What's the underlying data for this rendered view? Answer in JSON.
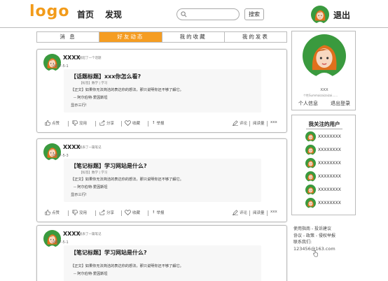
{
  "header": {
    "logo": "logo",
    "nav": [
      "首页",
      "发现"
    ],
    "search_placeholder": "",
    "search_button": "搜索",
    "logout": "退出"
  },
  "tabs": [
    {
      "label": "消 息",
      "active": false
    },
    {
      "label": "好友动态",
      "active": true
    },
    {
      "label": "我的收藏",
      "active": false
    },
    {
      "label": "我的发表",
      "active": false
    }
  ],
  "feed": [
    {
      "user": "XXXX",
      "action": "发起了一个话题",
      "date": "2017-5-1",
      "title": "【话题标题】xxx你怎么看?",
      "tags": "【标签】数学 | 学习",
      "body": "【正文】如果你无法简洁的表达你的想法，那只说明你还不够了解它。",
      "quote": "-- 阿尔伯特·爱因斯坦",
      "more": "显示三行!"
    },
    {
      "user": "XXXX",
      "action": "发表了一篇笔记",
      "date": "2017-5-3",
      "title": "【笔记标题】学习网站是什么?",
      "tags": "【标签】数学 | 学习",
      "body": "【正文】如果你无法简洁的表达你的想法，那只说明你还不够了解它。",
      "quote": "-- 阿尔伯特·爱因斯坦",
      "more": "显示三行!"
    },
    {
      "user": "XXXX",
      "action": "发表了一篇笔记",
      "date": "2017-5-1",
      "title": "【笔记标题】学习网站是什么?",
      "tags": "",
      "body": "【正文】如果你无法简洁的表达你的想法，那只说明你还不够了解它。",
      "quote": "-- 阿尔伯特·爱因斯坦",
      "more": ""
    }
  ],
  "card_actions": {
    "like": "点赞",
    "dislike": "没用",
    "share": "分享",
    "favorite": "收藏",
    "report": "举报",
    "comment": "评论",
    "views_label": "阅读量",
    "views_value": "xxx"
  },
  "profile": {
    "name": "XXX",
    "signature": "个性Summaizaizaizai......",
    "info_link": "个人信息",
    "logout_link": "退出登录"
  },
  "follows": {
    "title": "我关注的用户",
    "users": [
      "XXXXXXXX",
      "XXXXXXXX",
      "XXXXXXXX",
      "XXXXXXXX",
      "XXXXXXXX",
      "XXXXXXXX"
    ]
  },
  "footer": {
    "line1": "使用指南 - 投诉建议",
    "line2": "协议 - 政策 - 侵权举报",
    "line3": "联系我们:",
    "email": "123456@163.com"
  },
  "colors": {
    "accent": "#f59d22",
    "avatar_bg": "#3a9a3e",
    "hair": "#e0701c"
  }
}
